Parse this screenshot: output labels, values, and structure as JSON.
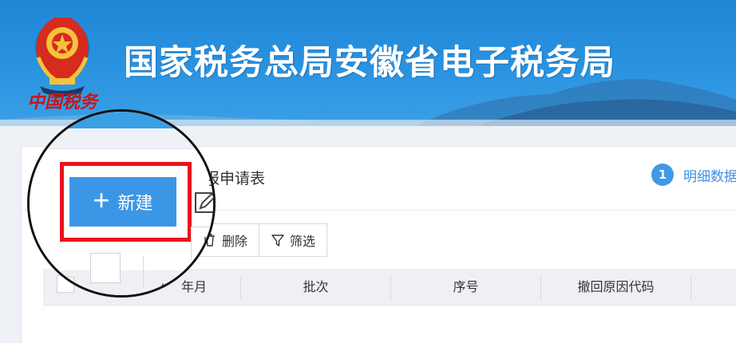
{
  "banner": {
    "site_title": "国家税务总局安徽省电子税务局",
    "logo_caption": "中国税务",
    "background_color": "#2a93e0"
  },
  "form": {
    "title_fragment": "报申请表",
    "title_fragment_zoomed": "报申请表"
  },
  "steps": [
    {
      "number": "1",
      "label": "明细数据"
    }
  ],
  "toolbar": {
    "new_label": "新建",
    "delete_label": "删除",
    "filter_label": "筛选"
  },
  "table": {
    "columns": [
      "年月",
      "批次",
      "序号",
      "撤回原因代码"
    ],
    "zoom_column": "年月"
  },
  "icons": {
    "new": "plus-icon",
    "edit": "edit-icon",
    "delete": "trash-icon",
    "filter": "filter-icon",
    "emblem": "national-emblem-icon"
  },
  "colors": {
    "primary_button": "#3b96e6",
    "highlight_frame": "#e8141c",
    "step_badge": "#3f99e6",
    "step_text": "#3f8fdf"
  }
}
